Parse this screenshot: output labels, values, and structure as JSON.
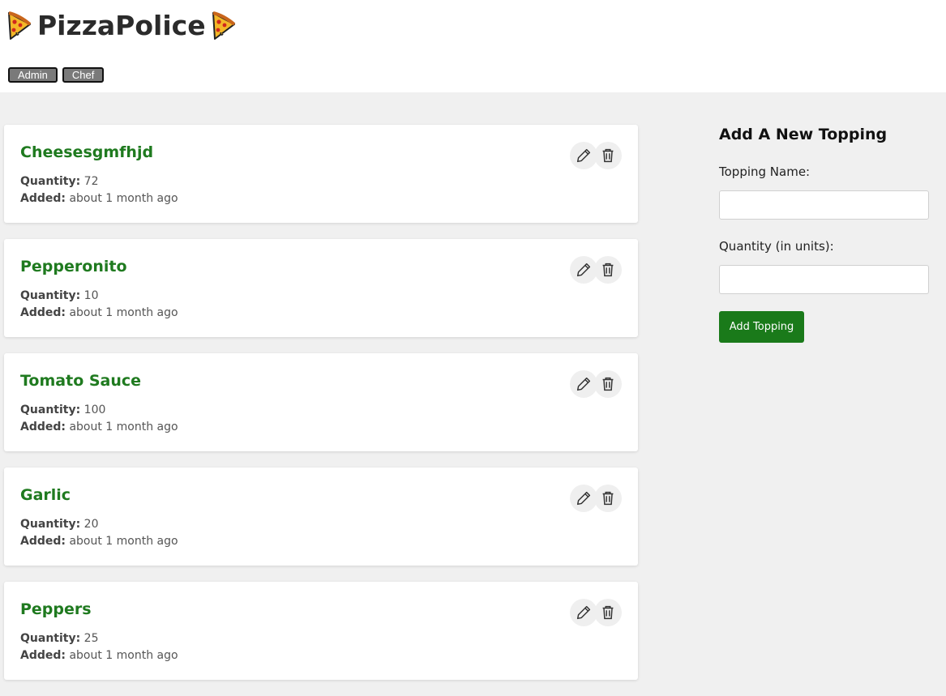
{
  "app": {
    "title": "PizzaPolice",
    "roles": [
      "Admin",
      "Chef"
    ]
  },
  "labels": {
    "quantity": "Quantity:",
    "added": "Added:"
  },
  "toppings": [
    {
      "name": "Cheesesgmfhjd",
      "quantity": "72",
      "added": "about 1 month ago"
    },
    {
      "name": "Pepperonito",
      "quantity": "10",
      "added": "about 1 month ago"
    },
    {
      "name": "Tomato Sauce",
      "quantity": "100",
      "added": "about 1 month ago"
    },
    {
      "name": "Garlic",
      "quantity": "20",
      "added": "about 1 month ago"
    },
    {
      "name": "Peppers",
      "quantity": "25",
      "added": "about 1 month ago"
    }
  ],
  "form": {
    "heading": "Add A New Topping",
    "name_label": "Topping Name:",
    "name_value": "",
    "quantity_label": "Quantity (in units):",
    "quantity_value": "",
    "submit_label": "Add Topping"
  },
  "icons": {
    "brand": "pizza-slice-icon",
    "edit": "pencil-icon",
    "delete": "trash-icon"
  },
  "colors": {
    "accent_green": "#1a7a1a",
    "topping_name": "#1f7a1f",
    "role_button": "#7a7a7a",
    "background": "#f0f0f0"
  }
}
